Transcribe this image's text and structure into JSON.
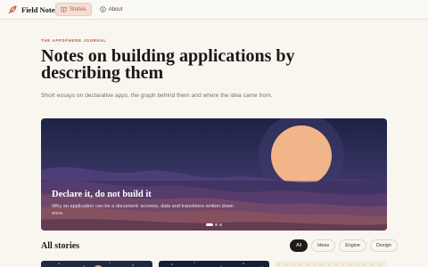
{
  "brand": {
    "name": "Field Notes"
  },
  "nav": {
    "items": [
      {
        "label": "Stories",
        "icon": "book-icon",
        "active": true
      },
      {
        "label": "About",
        "icon": "info-icon",
        "active": false
      }
    ]
  },
  "hero": {
    "eyebrow": "THE APPSPHERE JOURNAL",
    "headline": "Notes on building applications by describing them",
    "subtitle": "Short essays on declarative apps, the graph behind them and where the idea came from."
  },
  "feature": {
    "title": "Declare it, do not build it",
    "description": "Why an application can be a document: screens, data and transitions written down once.",
    "slide_count": 3,
    "active_slide": 1
  },
  "stories": {
    "title": "All stories",
    "filters": [
      {
        "label": "All",
        "active": true
      },
      {
        "label": "Ideas",
        "active": false
      },
      {
        "label": "Engine",
        "active": false
      },
      {
        "label": "Design",
        "active": false
      }
    ]
  },
  "colors": {
    "accent": "#c8553f",
    "background": "#f9f6f0",
    "ink": "#1b1916"
  }
}
